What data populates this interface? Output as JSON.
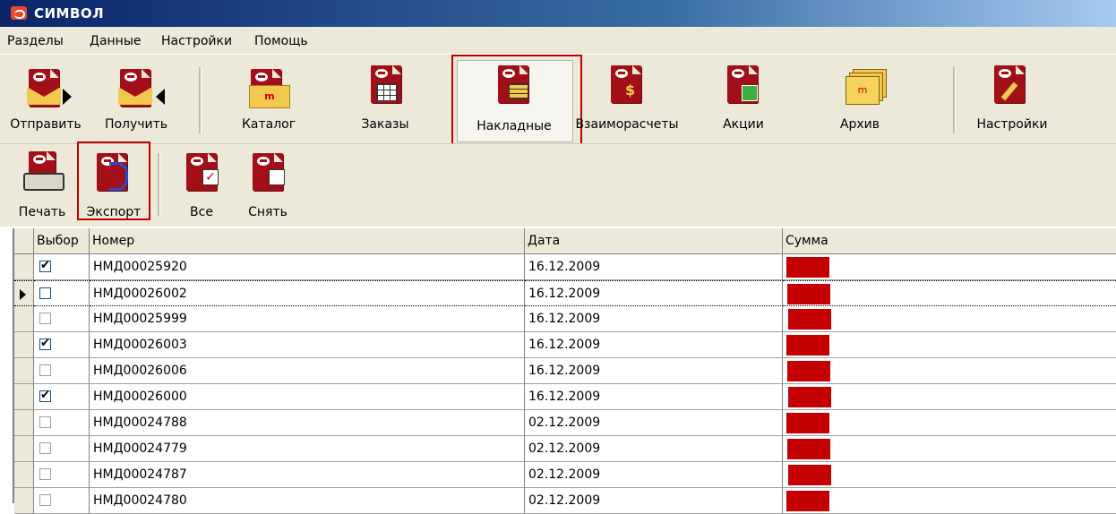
{
  "window": {
    "title": "СИМВОЛ"
  },
  "menu": [
    "Разделы",
    "Данные",
    "Настройки",
    "Помощь"
  ],
  "toolbar_main": [
    {
      "label": "Отправить",
      "icon": "send-mail-icon"
    },
    {
      "label": "Получить",
      "icon": "receive-mail-icon"
    },
    {
      "label": "Каталог",
      "icon": "catalog-folder-icon"
    },
    {
      "label": "Заказы",
      "icon": "orders-icon"
    },
    {
      "label": "Накладные",
      "icon": "invoices-icon",
      "selected": true
    },
    {
      "label": "Взаиморасчеты",
      "icon": "settlements-icon"
    },
    {
      "label": "Акции",
      "icon": "promotions-icon"
    },
    {
      "label": "Архив",
      "icon": "archive-icon"
    },
    {
      "label": "Настройки",
      "icon": "settings-icon"
    }
  ],
  "toolbar_sub": [
    {
      "label": "Печать",
      "icon": "printer-icon"
    },
    {
      "label": "Экспорт",
      "icon": "export-icon",
      "highlighted": true
    },
    {
      "label": "Все",
      "icon": "select-all-icon"
    },
    {
      "label": "Снять",
      "icon": "deselect-icon"
    }
  ],
  "grid": {
    "columns": [
      "Выбор",
      "Номер",
      "Дата",
      "Сумма"
    ],
    "rows": [
      {
        "checked": true,
        "number": "НМД00025920",
        "date": "16.12.2009"
      },
      {
        "checked": false,
        "number": "НМД00026002",
        "date": "16.12.2009",
        "current": true
      },
      {
        "checked": false,
        "number": "НМД00025999",
        "date": "16.12.2009"
      },
      {
        "checked": true,
        "number": "НМД00026003",
        "date": "16.12.2009"
      },
      {
        "checked": false,
        "number": "НМД00026006",
        "date": "16.12.2009"
      },
      {
        "checked": true,
        "number": "НМД00026000",
        "date": "16.12.2009"
      },
      {
        "checked": false,
        "number": "НМД00024788",
        "date": "02.12.2009"
      },
      {
        "checked": false,
        "number": "НМД00024779",
        "date": "02.12.2009"
      },
      {
        "checked": false,
        "number": "НМД00024787",
        "date": "02.12.2009"
      },
      {
        "checked": false,
        "number": "НМД00024780",
        "date": "02.12.2009"
      }
    ]
  },
  "colors": {
    "highlight": "#c00000",
    "redaction": "#c40000",
    "doc_icon": "#a30f18"
  }
}
